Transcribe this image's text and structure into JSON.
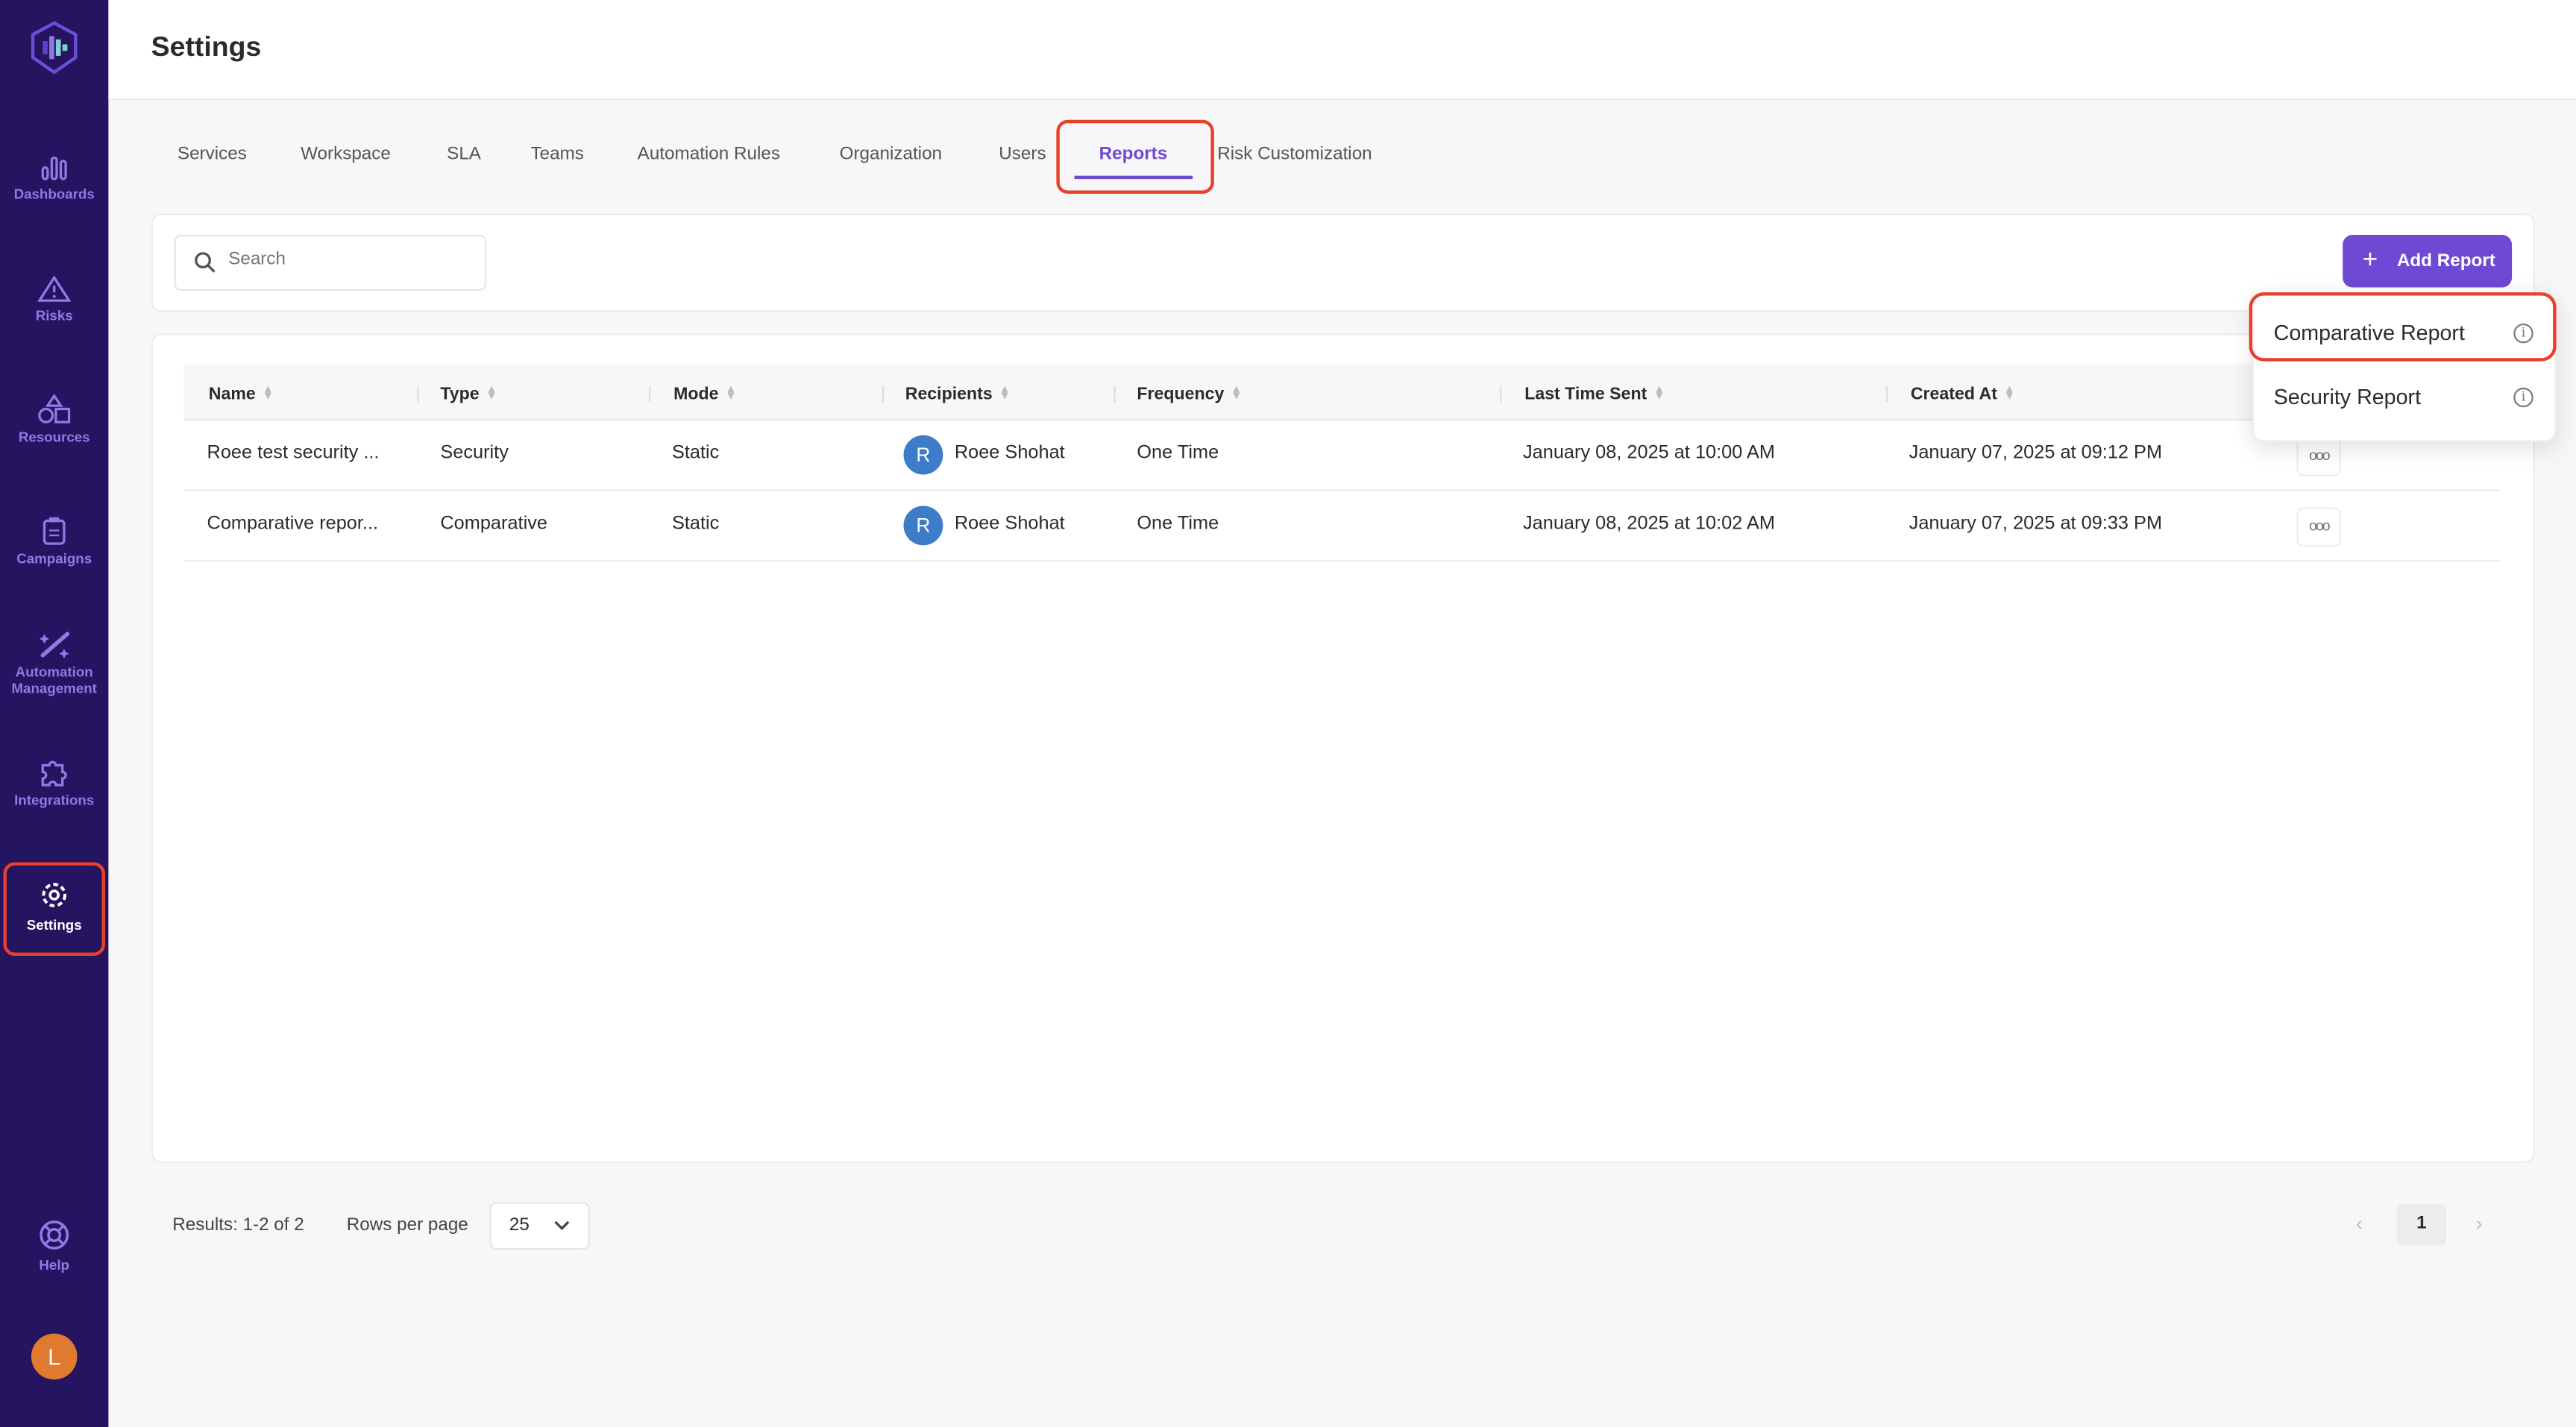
{
  "sidebar": {
    "items": [
      {
        "label": "Dashboards",
        "icon": "bar-chart-icon"
      },
      {
        "label": "Risks",
        "icon": "warning-icon"
      },
      {
        "label": "Resources",
        "icon": "shapes-icon"
      },
      {
        "label": "Campaigns",
        "icon": "clipboard-icon"
      },
      {
        "label": "Automation Management",
        "icon": "magic-wand-icon"
      },
      {
        "label": "Integrations",
        "icon": "puzzle-icon"
      },
      {
        "label": "Settings",
        "icon": "gear-icon",
        "active": true
      }
    ],
    "help": "Help",
    "avatar": "L",
    "avatar_color": "#e07a2e"
  },
  "header": {
    "title": "Settings"
  },
  "tabs": [
    "Services",
    "Workspace",
    "SLA",
    "Teams",
    "Automation Rules",
    "Organization",
    "Users",
    "Reports",
    "Risk Customization"
  ],
  "active_tab": "Reports",
  "search": {
    "placeholder": "Search",
    "value": ""
  },
  "add_report": {
    "label": "Add Report",
    "color": "#6f48d4"
  },
  "dropdown": {
    "items": [
      "Comparative Report",
      "Security Report"
    ]
  },
  "table": {
    "columns": [
      "Name",
      "Type",
      "Mode",
      "Recipients",
      "Frequency",
      "Last Time Sent",
      "Created At"
    ],
    "rows": [
      {
        "name": "Roee test security ...",
        "type": "Security",
        "mode": "Static",
        "recipient_initial": "R",
        "recipient": "Roee Shohat",
        "frequency": "One Time",
        "last_sent": "January 08, 2025 at 10:00 AM",
        "created": "January 07, 2025 at 09:12 PM"
      },
      {
        "name": "Comparative repor...",
        "type": "Comparative",
        "mode": "Static",
        "recipient_initial": "R",
        "recipient": "Roee Shohat",
        "frequency": "One Time",
        "last_sent": "January 08, 2025 at 10:02 AM",
        "created": "January 07, 2025 at 09:33 PM"
      }
    ]
  },
  "footer": {
    "results": "Results: 1-2 of 2",
    "rows_per_page_label": "Rows per page",
    "rows_per_page": "25",
    "page": "1"
  }
}
